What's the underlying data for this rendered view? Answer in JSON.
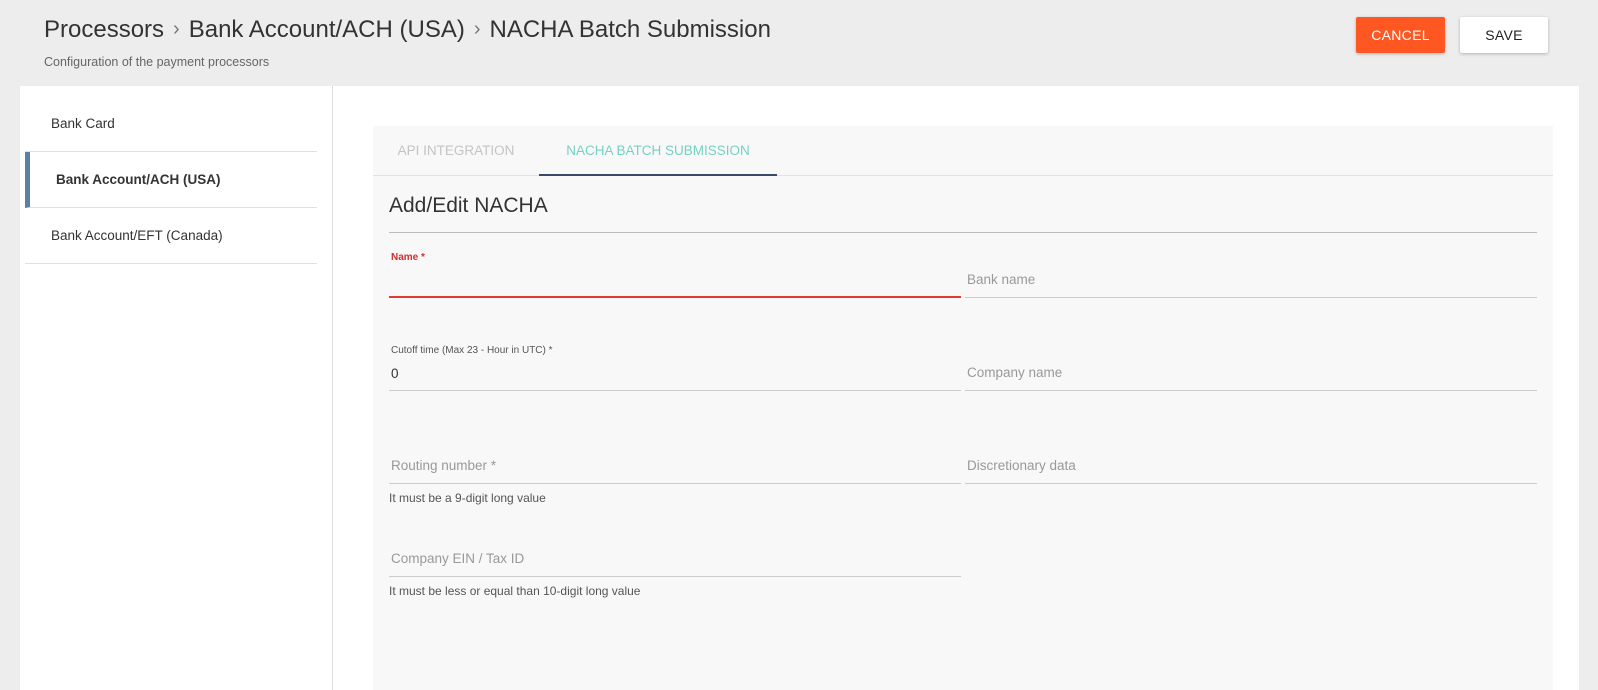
{
  "header": {
    "breadcrumb": [
      "Processors",
      "Bank Account/ACH (USA)",
      "NACHA Batch Submission"
    ],
    "subtitle": "Configuration of the payment processors",
    "cancel_label": "CANCEL",
    "save_label": "SAVE"
  },
  "sidebar": {
    "items": [
      {
        "label": "Bank Card"
      },
      {
        "label": "Bank Account/ACH (USA)"
      },
      {
        "label": "Bank Account/EFT (Canada)"
      }
    ]
  },
  "tabs": [
    {
      "label": "API INTEGRATION"
    },
    {
      "label": "NACHA BATCH SUBMISSION"
    }
  ],
  "form": {
    "title": "Add/Edit NACHA",
    "name": {
      "label": "Name *",
      "value": ""
    },
    "bank_name": {
      "placeholder": "Bank name"
    },
    "cutoff_time": {
      "label": "Cutoff time (Max 23 - Hour in UTC) *",
      "value": "0"
    },
    "company_name": {
      "placeholder": "Company name"
    },
    "routing_number": {
      "placeholder": "Routing number *",
      "hint": "It must be a 9-digit long value"
    },
    "discretionary_data": {
      "placeholder": "Discretionary data"
    },
    "company_ein": {
      "placeholder": "Company EIN / Tax ID",
      "hint": "It must be less or equal than 10-digit long value"
    }
  },
  "colors": {
    "cancel_bg": "#ff5722",
    "active_tab": "#75d1c3",
    "error": "#e53935",
    "active_nav_border": "#5c7fa5"
  }
}
